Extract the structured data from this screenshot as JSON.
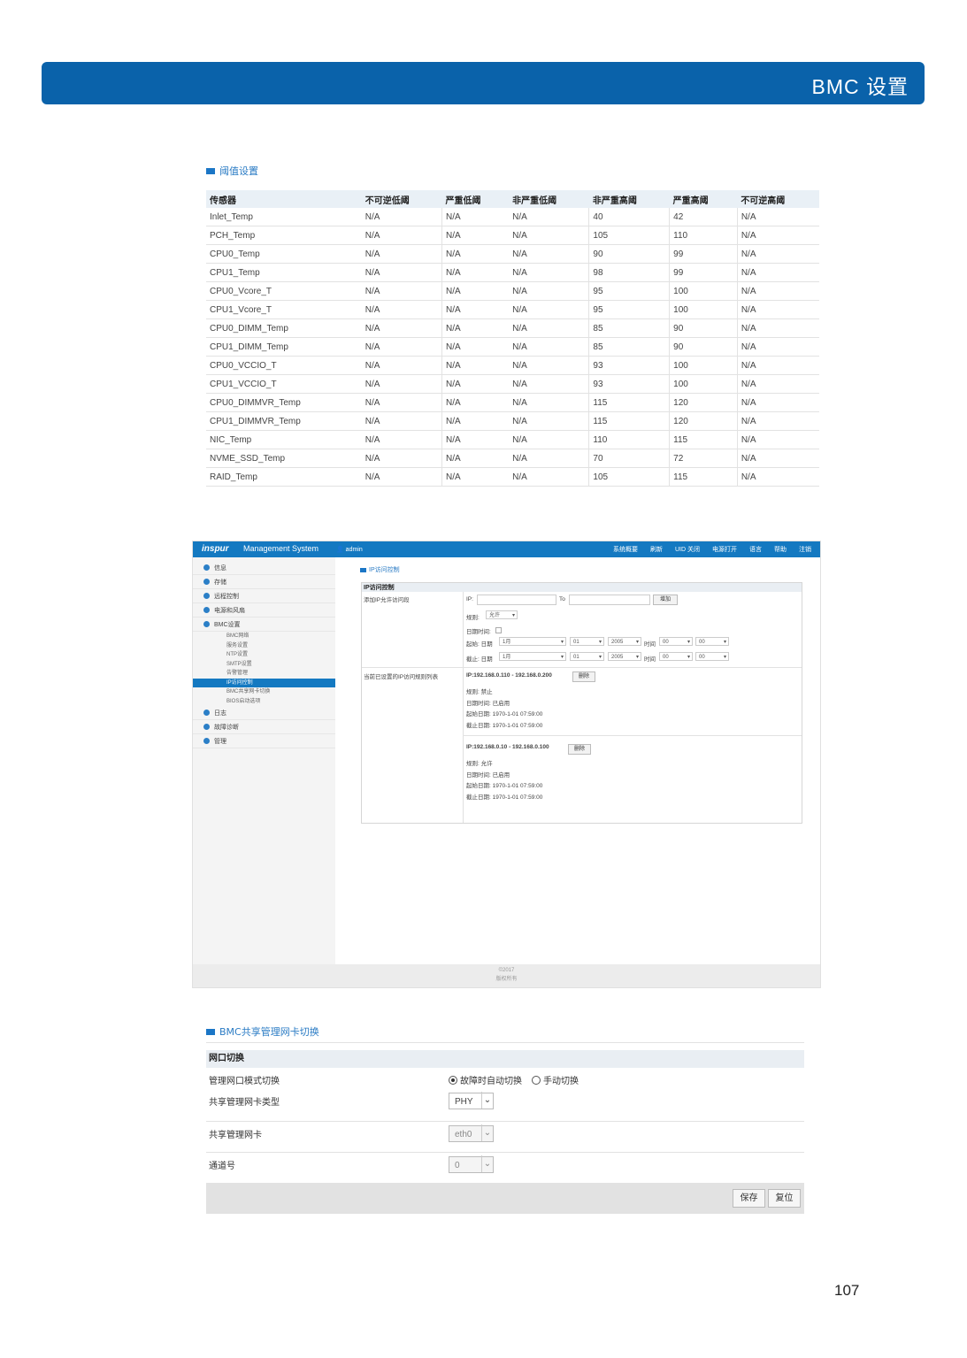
{
  "banner": {
    "title": "BMC 设置"
  },
  "threshold_section": {
    "title": "阈值设置",
    "headers": [
      "传感器",
      "不可逆低阈",
      "严重低阈",
      "非严重低阈",
      "非严重高阈",
      "严重高阈",
      "不可逆高阈"
    ],
    "rows": [
      [
        "Inlet_Temp",
        "N/A",
        "N/A",
        "N/A",
        "40",
        "42",
        "N/A"
      ],
      [
        "PCH_Temp",
        "N/A",
        "N/A",
        "N/A",
        "105",
        "110",
        "N/A"
      ],
      [
        "CPU0_Temp",
        "N/A",
        "N/A",
        "N/A",
        "90",
        "99",
        "N/A"
      ],
      [
        "CPU1_Temp",
        "N/A",
        "N/A",
        "N/A",
        "98",
        "99",
        "N/A"
      ],
      [
        "CPU0_Vcore_T",
        "N/A",
        "N/A",
        "N/A",
        "95",
        "100",
        "N/A"
      ],
      [
        "CPU1_Vcore_T",
        "N/A",
        "N/A",
        "N/A",
        "95",
        "100",
        "N/A"
      ],
      [
        "CPU0_DIMM_Temp",
        "N/A",
        "N/A",
        "N/A",
        "85",
        "90",
        "N/A"
      ],
      [
        "CPU1_DIMM_Temp",
        "N/A",
        "N/A",
        "N/A",
        "85",
        "90",
        "N/A"
      ],
      [
        "CPU0_VCCIO_T",
        "N/A",
        "N/A",
        "N/A",
        "93",
        "100",
        "N/A"
      ],
      [
        "CPU1_VCCIO_T",
        "N/A",
        "N/A",
        "N/A",
        "93",
        "100",
        "N/A"
      ],
      [
        "CPU0_DIMMVR_Temp",
        "N/A",
        "N/A",
        "N/A",
        "115",
        "120",
        "N/A"
      ],
      [
        "CPU1_DIMMVR_Temp",
        "N/A",
        "N/A",
        "N/A",
        "115",
        "120",
        "N/A"
      ],
      [
        "NIC_Temp",
        "N/A",
        "N/A",
        "N/A",
        "110",
        "115",
        "N/A"
      ],
      [
        "NVME_SSD_Temp",
        "N/A",
        "N/A",
        "N/A",
        "70",
        "72",
        "N/A"
      ],
      [
        "RAID_Temp",
        "N/A",
        "N/A",
        "N/A",
        "105",
        "115",
        "N/A"
      ]
    ]
  },
  "mgmt": {
    "logo": "inspur",
    "system": "Management System",
    "user": "admin",
    "nav": [
      "系统概要",
      "刷新",
      "UID 关闭",
      "电源打开",
      "语言",
      "帮助",
      "注销"
    ],
    "sidebar": {
      "items": [
        "信息",
        "存储",
        "远程控制",
        "电源和风扇",
        "BMC设置"
      ],
      "subitems": [
        "BMC网络",
        "服务设置",
        "NTP设置",
        "SMTP设置",
        "告警管理",
        "IP访问控制",
        "BMC共享网卡切换",
        "BIOS启动选项"
      ],
      "items_after": [
        "日志",
        "故障诊断",
        "管理"
      ]
    },
    "section_title": "IP访问控制",
    "box_title": "IP访问控制",
    "left_label_1": "添加IP允许访问段",
    "ip_label": "IP:",
    "to_label": "To",
    "add_button": "增加",
    "rule_label": "规则:",
    "rule_value": "允许",
    "date_label": "日期时间:",
    "start_label": "起始: 日期",
    "end_label": "截止: 日期",
    "time_label": "时间",
    "month_value": "1月",
    "day_value": "01",
    "year_value": "2005",
    "hour_value": "00",
    "minute_value": "00",
    "left_label_2": "当前已设置的IP访问规则列表",
    "rules": [
      {
        "range": "IP:192.168.0.110 - 192.168.0.200",
        "delete": "删除",
        "rule": "规则: 禁止",
        "datetime": "日期时间: 已启用",
        "start": "起始日期: 1970-1-01 07:59:00",
        "end": "截止日期: 1970-1-01 07:59:00"
      },
      {
        "range": "IP:192.168.0.10 - 192.168.0.100",
        "delete": "删除",
        "rule": "规则: 允许",
        "datetime": "日期时间: 已启用",
        "start": "起始日期: 1970-1-01 07:59:00",
        "end": "截止日期: 1970-1-01 07:59:00"
      }
    ],
    "footer_year": "©2017",
    "footer_rights": "版权所有"
  },
  "nic_section": {
    "title": "BMC共享管理网卡切换",
    "box_title": "网口切换",
    "mode_label": "管理网口模式切换",
    "mode_auto": "故障时自动切换",
    "mode_manual": "手动切换",
    "type_label": "共享管理网卡类型",
    "type_value": "PHY",
    "nic_label": "共享管理网卡",
    "nic_value": "eth0",
    "channel_label": "通道号",
    "channel_value": "0",
    "save": "保存",
    "reset": "复位"
  },
  "page_number": "107"
}
